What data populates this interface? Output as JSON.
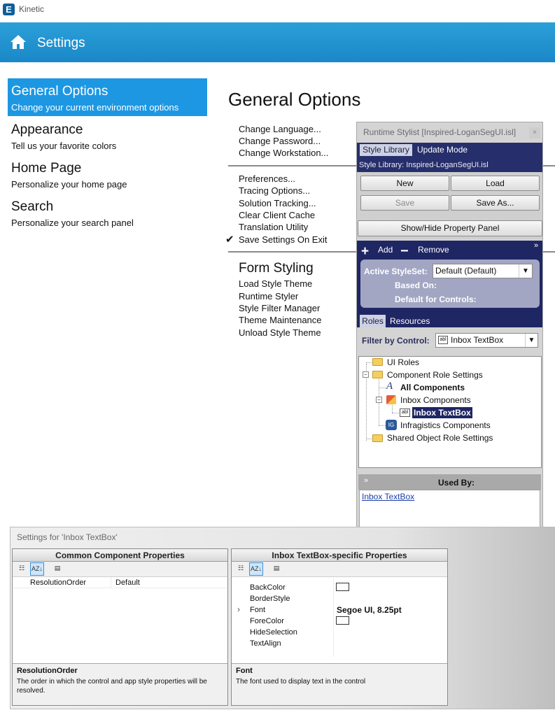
{
  "app": {
    "name": "Kinetic",
    "logo_letter": "E"
  },
  "header": {
    "title": "Settings",
    "home_icon": "home-icon"
  },
  "menu": [
    {
      "title": "General Options",
      "subtitle": "Change your current environment options",
      "selected": true
    },
    {
      "title": "Appearance",
      "subtitle": "Tell us your favorite colors",
      "selected": false
    },
    {
      "title": "Home Page",
      "subtitle": "Personalize your home page",
      "selected": false
    },
    {
      "title": "Search",
      "subtitle": "Personalize your search panel",
      "selected": false
    }
  ],
  "main": {
    "title": "General Options",
    "group1": [
      "Change Language...",
      "Change Password...",
      "Change Workstation..."
    ],
    "group2": [
      "Preferences...",
      "Tracing Options...",
      "Solution Tracking...",
      "Clear Client Cache",
      "Translation Utility",
      "Save Settings On Exit"
    ],
    "save_on_exit_checked": true,
    "form_styling": {
      "title": "Form Styling",
      "items": [
        "Load Style Theme",
        "Runtime Styler",
        "Style Filter Manager",
        "Theme Maintenance",
        "Unload Style Theme"
      ]
    }
  },
  "stylist": {
    "title": "Runtime Stylist [Inspired-LoganSegUI.isl]",
    "close_glyph": "×",
    "tabs": [
      "Style Library",
      "Update Mode"
    ],
    "library_label": "Style Library: Inspired-LoganSegUI.isl",
    "buttons": {
      "new": "New",
      "load": "Load",
      "save": "Save",
      "save_as": "Save As...",
      "show_hide": "Show/Hide Property Panel"
    },
    "add_label": "Add",
    "remove_label": "Remove",
    "active_styleset_label": "Active StyleSet:",
    "active_styleset_value": "Default (Default)",
    "based_on_label": "Based On:",
    "default_controls_label": "Default for Controls:",
    "sub_tabs": [
      "Roles",
      "Resources"
    ],
    "filter_label": "Filter by Control:",
    "filter_value": "Inbox TextBox",
    "filter_icon_text": "abl",
    "tree": {
      "ui_roles": "UI Roles",
      "component_role_settings": "Component Role Settings",
      "all_components": "All Components",
      "inbox_components": "Inbox Components",
      "inbox_textbox": "Inbox TextBox",
      "infragistics_components": "Infragistics Components",
      "shared_object": "Shared Object Role Settings"
    },
    "used_by_title": "Used By:",
    "used_by_items": [
      "Inbox TextBox"
    ]
  },
  "settings_dialog": {
    "title": "Settings for 'Inbox TextBox'",
    "common": {
      "header": "Common Component Properties",
      "rows": [
        {
          "name": "ResolutionOrder",
          "value": "Default"
        }
      ],
      "desc_title": "ResolutionOrder",
      "desc_text": "The order in which the control and app style properties will be resolved."
    },
    "specific": {
      "header": "Inbox TextBox-specific Properties",
      "rows": [
        {
          "name": "BackColor",
          "value": "",
          "swatch": "#ffffff"
        },
        {
          "name": "BorderStyle",
          "value": ""
        },
        {
          "name": "Font",
          "value": "Segoe UI, 8.25pt"
        },
        {
          "name": "ForeColor",
          "value": "",
          "swatch": "#ffffff"
        },
        {
          "name": "HideSelection",
          "value": ""
        },
        {
          "name": "TextAlign",
          "value": ""
        }
      ],
      "desc_title": "Font",
      "desc_text": "The font used to display text in the control"
    }
  },
  "colors": {
    "accent": "#1d97e2",
    "header": "#1a88c8",
    "stylist_navy": "#262f6b"
  }
}
